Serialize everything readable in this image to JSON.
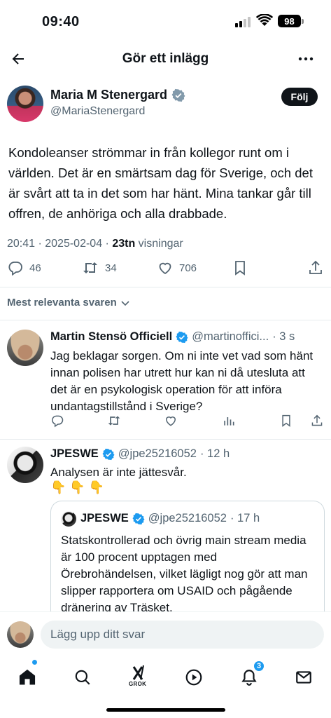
{
  "status_bar": {
    "time": "09:40",
    "battery": "98"
  },
  "header": {
    "title": "Gör ett inlägg"
  },
  "post": {
    "author_name": "Maria M Stenergard",
    "author_handle": "@MariaStenergard",
    "follow_label": "Följ",
    "text": "Kondoleanser strömmar in från kollegor runt om i världen. Det är en smärtsam dag för Sverige, och det är svårt att ta in det som har hänt. Mina tankar går till offren, de anhöriga och alla drabbade.",
    "time_date": "20:41 · 2025-02-04 · ",
    "views_count": "23tn",
    "views_label": " visningar",
    "replies": "46",
    "reposts": "34",
    "likes": "706"
  },
  "sort": {
    "label": "Mest relevanta svaren"
  },
  "replies": [
    {
      "name": "Martin Stensö Officiell",
      "handle": "@martinoffici...",
      "time": "· 3 s",
      "text": "Jag beklagar sorgen. Om ni inte vet vad som hänt innan polisen har utrett hur kan ni då utesluta att det är en psykologisk operation för att införa undantagstillstånd i Sverige?"
    },
    {
      "name": "JPESWE",
      "handle": "@jpe25216052",
      "time": "· 12 h",
      "text": "Analysen är inte jättesvår.",
      "emoji": "👇 👇 👇",
      "quote": {
        "name": "JPESWE",
        "handle": "@jpe25216052",
        "time": "· 17 h",
        "text": "Statskontrollerad och övrig main stream media är 100 procent upptagen med Örebrohändelsen, vilket lägligt nog gör att man slipper rapportera om USAID och pågående dränering av Träsket."
      }
    }
  ],
  "composer": {
    "placeholder": "Lägg upp ditt svar"
  },
  "bottom_nav": {
    "grok_label": "GROK",
    "notification_count": "3"
  },
  "colors": {
    "accent": "#1d9bf0",
    "text": "#0f1419",
    "muted": "#536471"
  }
}
